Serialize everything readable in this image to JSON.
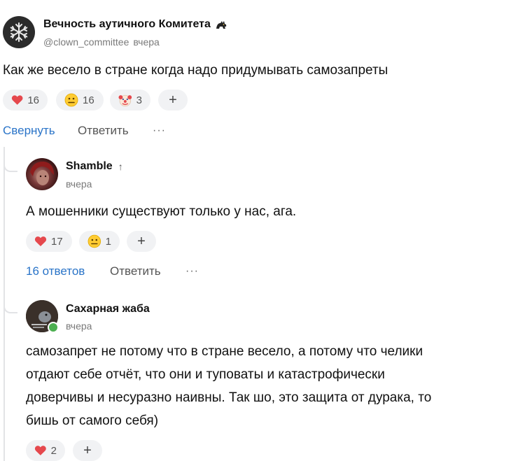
{
  "post": {
    "author": "Вечность аутичного Комитета",
    "handle": "@clown_committee",
    "time": "вчера",
    "text": "Как же весело в стране когда надо придумывать самозапреты",
    "reactions": [
      {
        "icon": "heart-icon",
        "count": "16"
      },
      {
        "icon": "neutral-face-icon",
        "count": "16"
      },
      {
        "icon": "clown-icon",
        "count": "3"
      }
    ],
    "collapse_label": "Свернуть",
    "reply_label": "Ответить",
    "more_label": "···"
  },
  "comments": [
    {
      "author": "Shamble",
      "arrow": "↑",
      "time": "вчера",
      "text": "А мошенники существуют только у нас, ага.",
      "reactions": [
        {
          "icon": "heart-icon",
          "count": "17"
        },
        {
          "icon": "neutral-face-icon",
          "count": "1"
        }
      ],
      "replies_label": "16 ответов",
      "reply_label": "Ответить",
      "more_label": "···"
    },
    {
      "author": "Сахарная жаба",
      "time": "вчера",
      "text_lines": [
        "самозапрет не потому что в стране весело, а потому что челики",
        "отдают себе отчёт, что они и туповаты и катастрофически",
        "доверчивы и несуразно наивны. Так шо, это защита от дурака, то",
        "бишь от самого себя)"
      ],
      "reactions": [
        {
          "icon": "heart-icon",
          "count": "2"
        }
      ]
    }
  ],
  "add_reaction_label": "+",
  "colors": {
    "link": "#2a74c8",
    "pill_bg": "#f1f2f4",
    "online": "#4caf50",
    "heart": "#e5484d"
  }
}
